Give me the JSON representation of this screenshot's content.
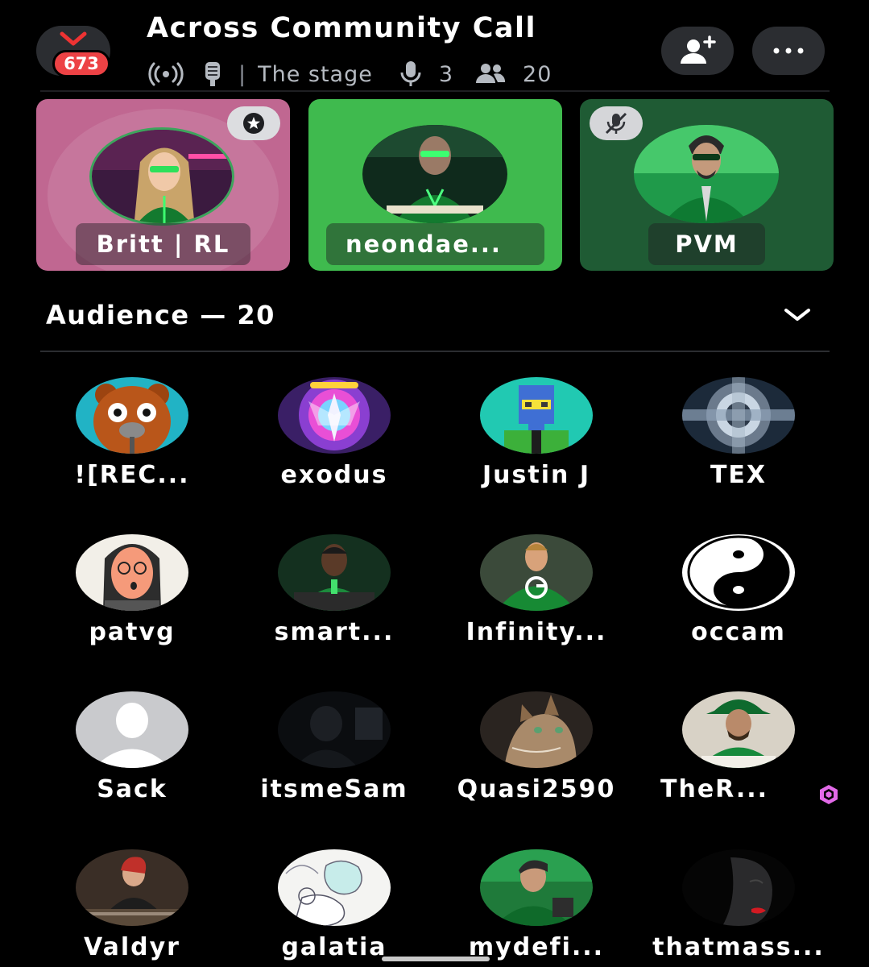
{
  "header": {
    "back_icon": "chevron-down-icon",
    "unread_count": "673",
    "title": "Across Community Call",
    "broadcast_icon": "broadcast-icon",
    "mic_stand_icon": "podium-microphone-icon",
    "separator": "|",
    "channel_name": "The stage",
    "speakers_icon": "microphone-icon",
    "speaker_count": "3",
    "listeners_icon": "users-icon",
    "listener_count": "20",
    "add_user_icon": "add-user-icon",
    "more_icon": "more-horizontal-icon"
  },
  "stage": {
    "speakers": [
      {
        "name": "Britt | RL",
        "badge": "moderator-shield-icon",
        "tile_color": "#c06791"
      },
      {
        "name": "neondae...",
        "tile_color": "#3fba4e"
      },
      {
        "name": "PVM",
        "badge": "muted-microphone-icon",
        "tile_color": "#1f5b34"
      }
    ]
  },
  "audience": {
    "heading": "Audience — 20",
    "toggle_icon": "chevron-down-icon",
    "members": [
      {
        "name": "![REC..."
      },
      {
        "name": "exodus"
      },
      {
        "name": "Justin J"
      },
      {
        "name": "TEX"
      },
      {
        "name": "patvg"
      },
      {
        "name": "smart..."
      },
      {
        "name": "Infinity..."
      },
      {
        "name": "occam"
      },
      {
        "name": "Sack"
      },
      {
        "name": "itsmeSam"
      },
      {
        "name": "Quasi2590"
      },
      {
        "name": "TheR...",
        "badge": "nitro-boost-icon"
      },
      {
        "name": "Valdyr"
      },
      {
        "name": "galatia"
      },
      {
        "name": "mydefi..."
      },
      {
        "name": "thatmass..."
      }
    ]
  },
  "colors": {
    "background": "#000000",
    "badge_red": "#ed4245",
    "button_gray": "#2b2d31",
    "nitro_pink": "#e26ae8"
  }
}
